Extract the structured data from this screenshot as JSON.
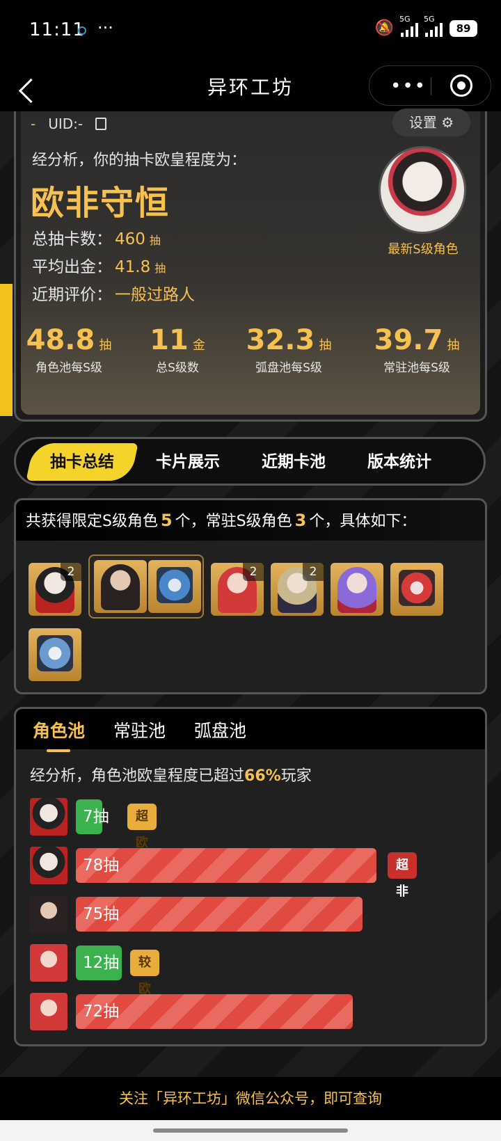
{
  "status": {
    "time": "11:11",
    "more": "···",
    "sig1": "5G",
    "sig2": "5G",
    "battery": "89"
  },
  "header": {
    "title": "异环工坊",
    "capsule_dots": "•••"
  },
  "profile": {
    "uid_prefix": "-",
    "uid": "UID:-",
    "settings_label": "设置 ⚙",
    "analysis_text": "经分析，你的抽卡欧皇程度为：",
    "verdict": "欧非守恒",
    "stats": [
      {
        "label": "总抽卡数：",
        "value": "460",
        "unit": "抽"
      },
      {
        "label": "平均出金：",
        "value": "41.8",
        "unit": "抽"
      },
      {
        "label": "近期评价：",
        "value": "一般过路人",
        "unit": ""
      }
    ],
    "avatar_caption": "最新S级角色",
    "metrics": [
      {
        "value": "48.8",
        "unit": "抽",
        "label": "角色池每S级"
      },
      {
        "value": "11",
        "unit": "金",
        "label": "总S级数"
      },
      {
        "value": "32.3",
        "unit": "抽",
        "label": "弧盘池每S级"
      },
      {
        "value": "39.7",
        "unit": "抽",
        "label": "常驻池每S级"
      }
    ]
  },
  "tabs": [
    "抽卡总结",
    "卡片展示",
    "近期卡池",
    "版本统计"
  ],
  "summary": {
    "p1": "共获得限定S级角色",
    "limited": "5",
    "p2": "个，常驻S级角色",
    "standard": "3",
    "p3": "个，具体如下：",
    "counts": [
      "2",
      "2",
      "2"
    ]
  },
  "pool": {
    "tabs": [
      "角色池",
      "常驻池",
      "弧盘池"
    ],
    "analysis_p1": "经分析，角色池欧皇程度已超过",
    "percent": "66%",
    "analysis_p2": "玩家",
    "rows": [
      {
        "pulls": "7抽",
        "badge": "超欧"
      },
      {
        "pulls": "78抽",
        "badge": "超非"
      },
      {
        "pulls": "75抽",
        "badge": ""
      },
      {
        "pulls": "12抽",
        "badge": "较欧"
      },
      {
        "pulls": "72抽",
        "badge": ""
      }
    ]
  },
  "footer": {
    "text": "关注「异环工坊」微信公众号，即可查询"
  },
  "colors": {
    "accent": "#f6c150",
    "tab_active": "#f4d42a",
    "good": "#3bb24e",
    "bad": "#e04a40"
  }
}
